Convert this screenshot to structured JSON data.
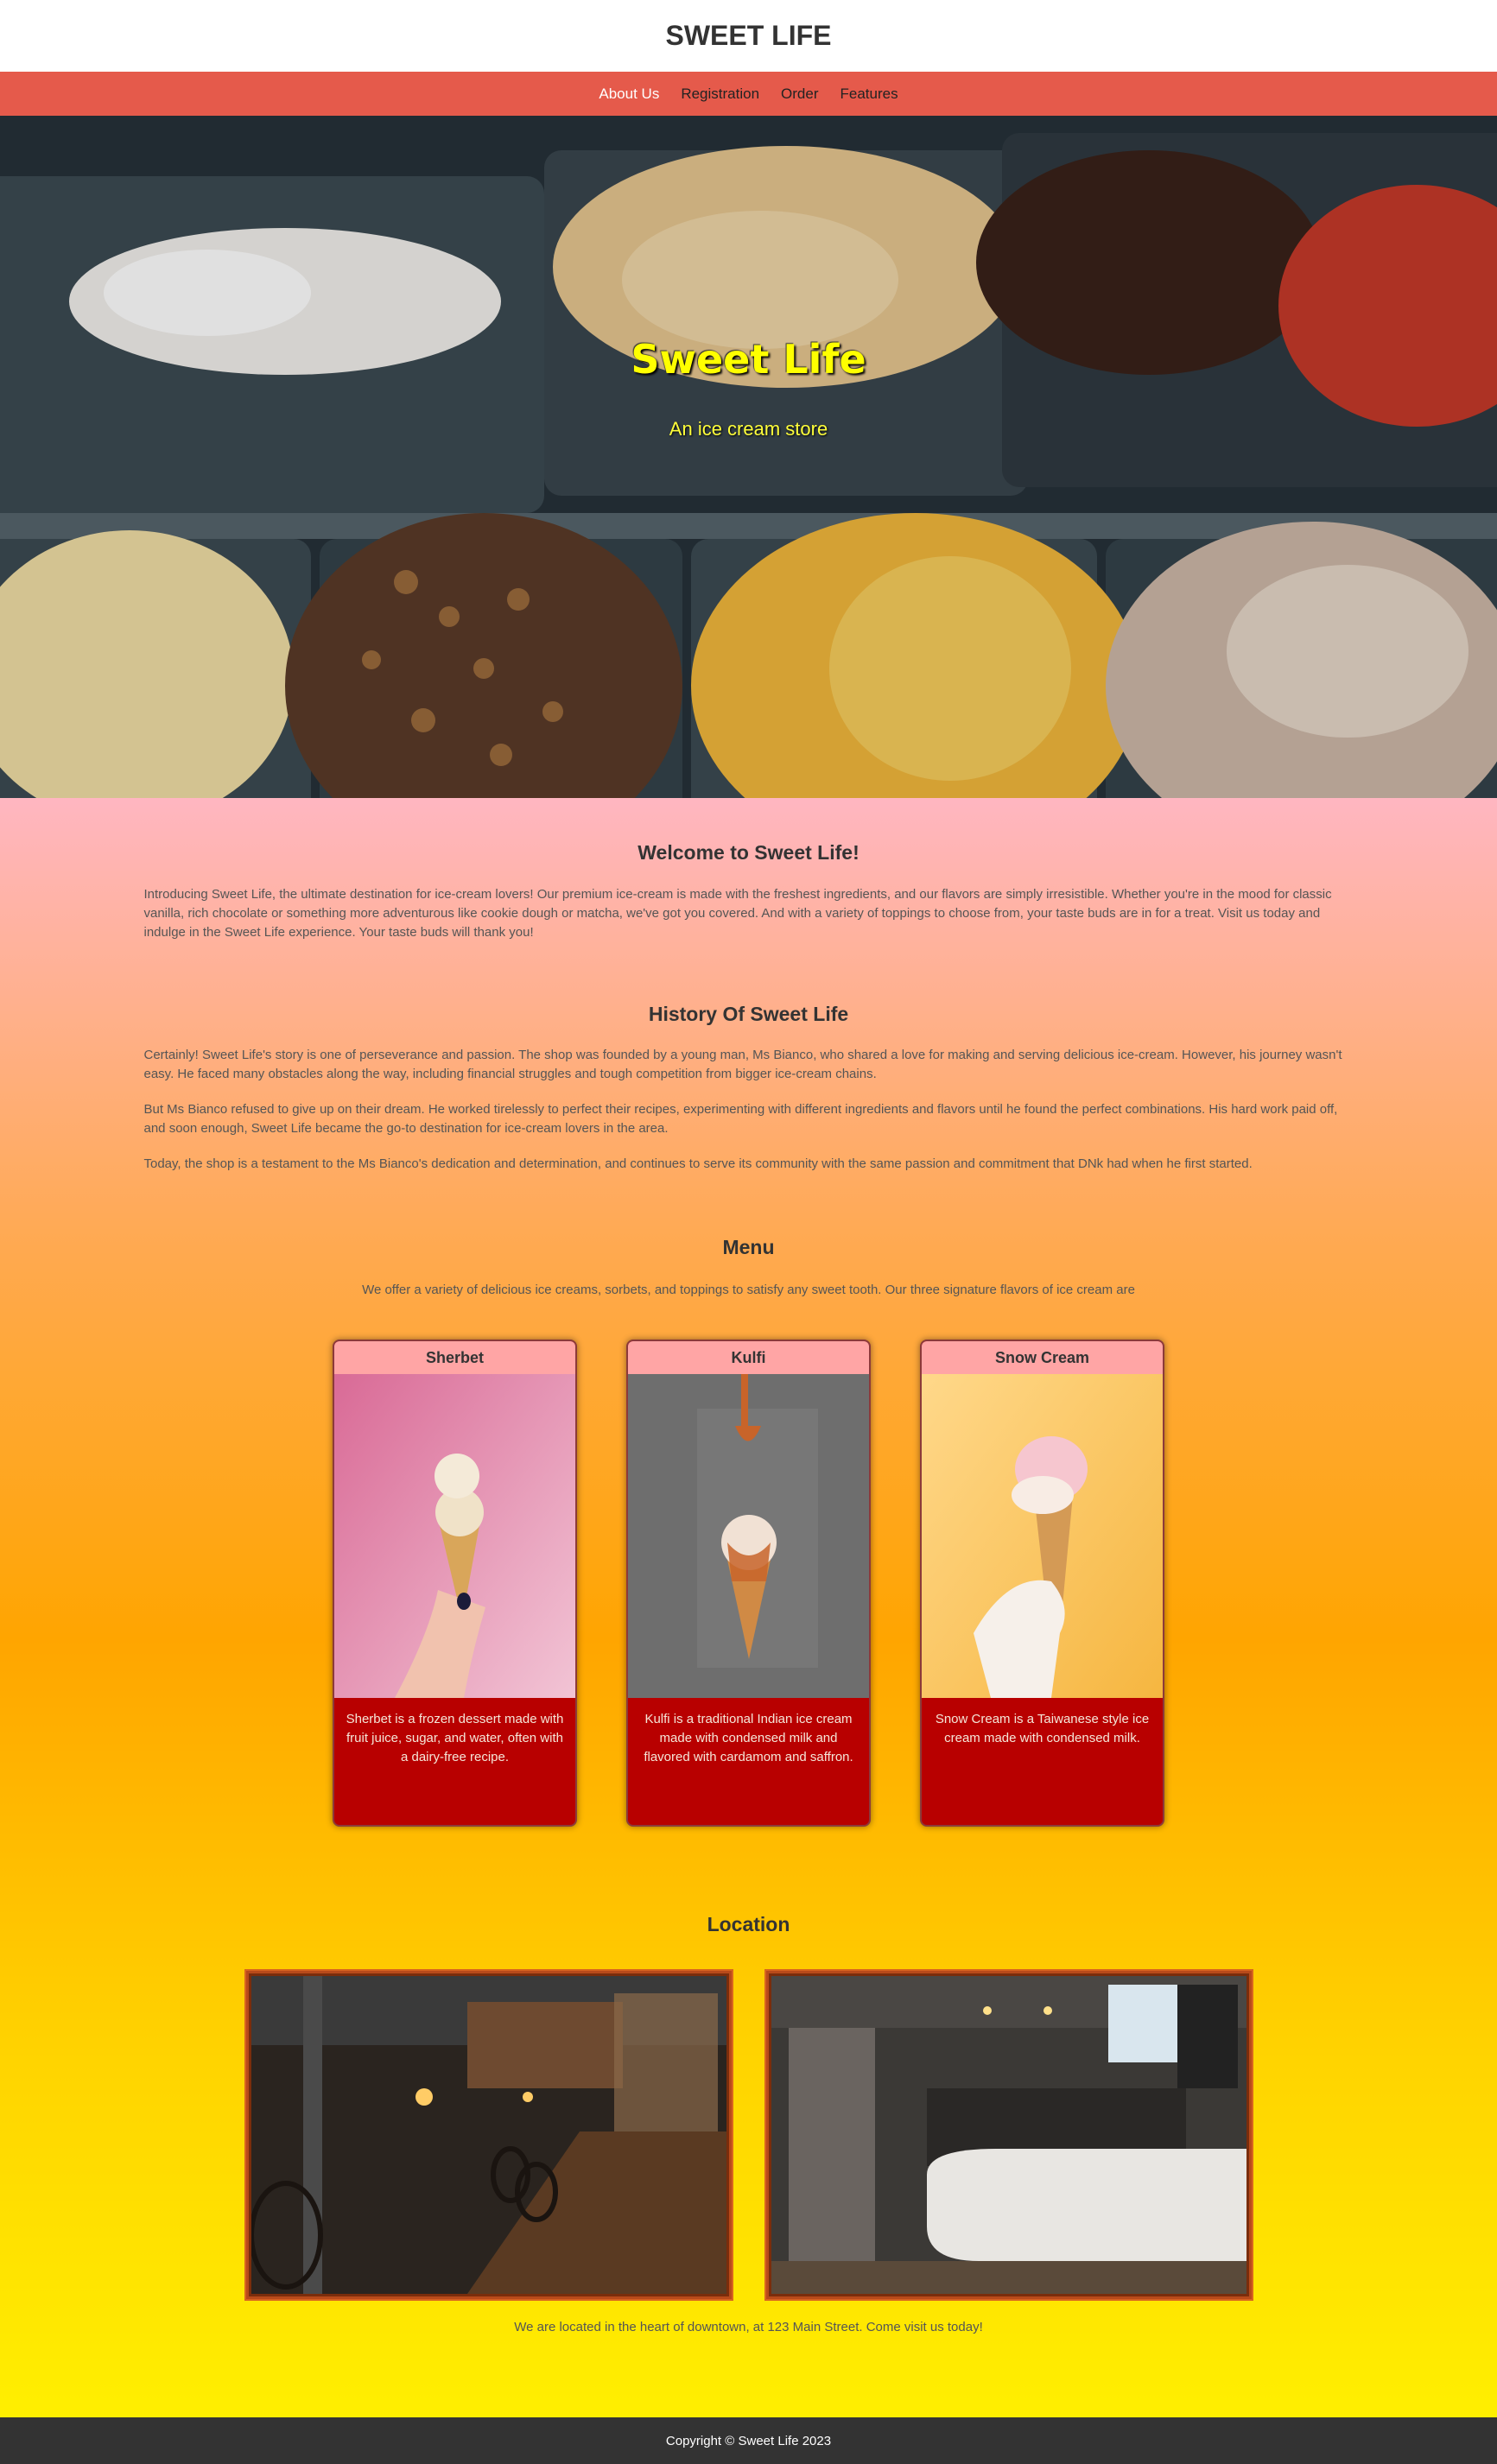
{
  "header": {
    "title": "SWEET LIFE"
  },
  "nav": {
    "items": [
      {
        "label": "About Us"
      },
      {
        "label": "Registration"
      },
      {
        "label": "Order"
      },
      {
        "label": "Features"
      }
    ]
  },
  "hero": {
    "title": "Sweet Life",
    "subtitle": "An ice cream store",
    "image": "ice-cream-display-photo"
  },
  "welcome": {
    "heading": "Welcome to Sweet Life!",
    "text": "Introducing Sweet Life, the ultimate destination for ice-cream lovers! Our premium ice-cream is made with the freshest ingredients, and our flavors are simply irresistible. Whether you're in the mood for classic vanilla, rich chocolate or something more adventurous like cookie dough or matcha, we've got you covered. And with a variety of toppings to choose from, your taste buds are in for a treat. Visit us today and indulge in the Sweet Life experience. Your taste buds will thank you!"
  },
  "history": {
    "heading": "History Of Sweet Life",
    "paragraphs": [
      "Certainly! Sweet Life's story is one of perseverance and passion. The shop was founded by a young man, Ms Bianco, who shared a love for making and serving delicious ice-cream. However, his journey wasn't easy. He faced many obstacles along the way, including financial struggles and tough competition from bigger ice-cream chains.",
      "But Ms Bianco refused to give up on their dream. He worked tirelessly to perfect their recipes, experimenting with different ingredients and flavors until he found the perfect combinations. His hard work paid off, and soon enough, Sweet Life became the go-to destination for ice-cream lovers in the area.",
      "Today, the shop is a testament to the Ms Bianco's dedication and determination, and continues to serve its community with the same passion and commitment that DNk had when he first started."
    ]
  },
  "menu": {
    "heading": "Menu",
    "intro": "We offer a variety of delicious ice creams, sorbets, and toppings to satisfy any sweet tooth. Our three signature flavors of ice cream are",
    "items": [
      {
        "name": "Sherbet",
        "description": "Sherbet is a frozen dessert made with fruit juice, sugar, and water, often with a dairy-free recipe."
      },
      {
        "name": "Kulfi",
        "description": "Kulfi is a traditional Indian ice cream made with condensed milk and flavored with cardamom and saffron."
      },
      {
        "name": "Snow Cream",
        "description": "Snow Cream is a Taiwanese style ice cream made with condensed milk."
      }
    ]
  },
  "location": {
    "heading": "Location",
    "caption": "We are located in the heart of downtown, at 123 Main Street. Come visit us today!"
  },
  "footer": {
    "text": "Copyright © Sweet Life 2023"
  },
  "colors": {
    "nav_bg": "#e55a4b",
    "card_body": "#b80000",
    "card_head": "#ffa5a5",
    "hero_title": "#ffff00",
    "footer_bg": "#333333"
  }
}
